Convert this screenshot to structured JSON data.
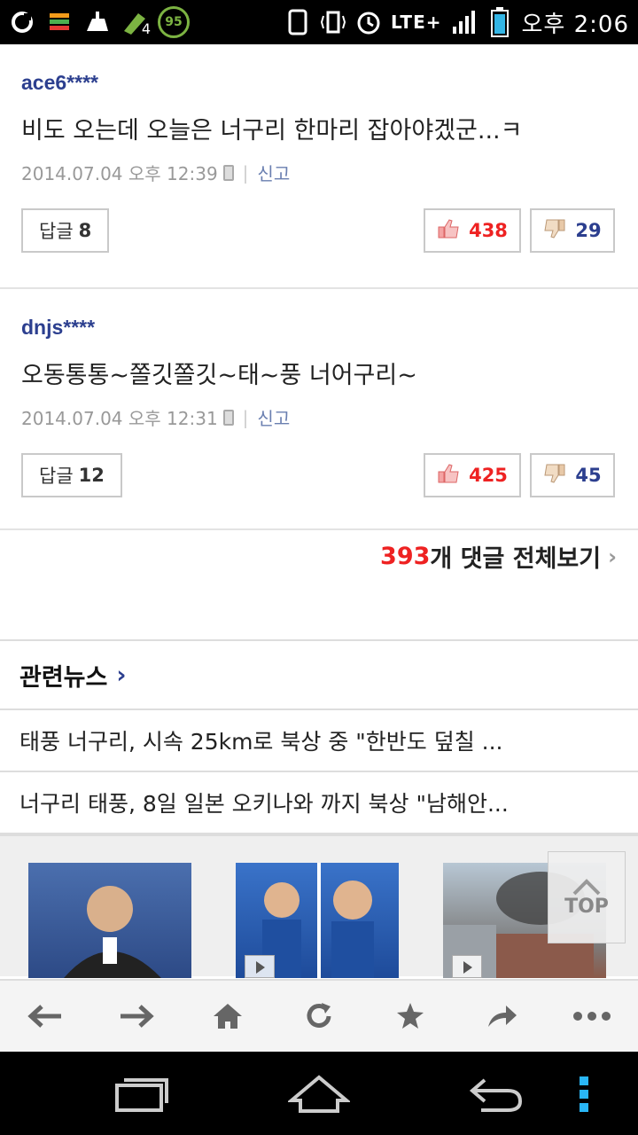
{
  "status_bar": {
    "network": "LTE+",
    "battery_level": "95",
    "notif_count": "4",
    "time": "오후 2:06"
  },
  "comments": [
    {
      "author": "ace6****",
      "text": "비도 오는데 오늘은 너구리 한마리 잡아야겠군...ㅋ",
      "timestamp": "2014.07.04 오후 12:39",
      "report_label": "신고",
      "reply_label": "답글",
      "reply_count": "8",
      "likes": "438",
      "dislikes": "29"
    },
    {
      "author": "dnjs****",
      "text": "오동통통~쫄깃쫄깃~태~풍 너어구리~",
      "timestamp": "2014.07.04 오후 12:31",
      "report_label": "신고",
      "reply_label": "답글",
      "reply_count": "12",
      "likes": "425",
      "dislikes": "45"
    }
  ],
  "all_comments": {
    "count": "393",
    "label": "개 댓글 전체보기"
  },
  "related_news": {
    "title": "관련뉴스",
    "items": [
      "태풍 너구리, 시속 25km로 북상 중 \"한반도 덮칠 ...",
      "너구리 태풍, 8일 일본 오키나와 까지 북상 \"남해안..."
    ]
  },
  "top_button": {
    "label": "TOP"
  },
  "colors": {
    "author": "#2c3f8f",
    "like": "#ee2222",
    "accent_red": "#ee2222"
  }
}
